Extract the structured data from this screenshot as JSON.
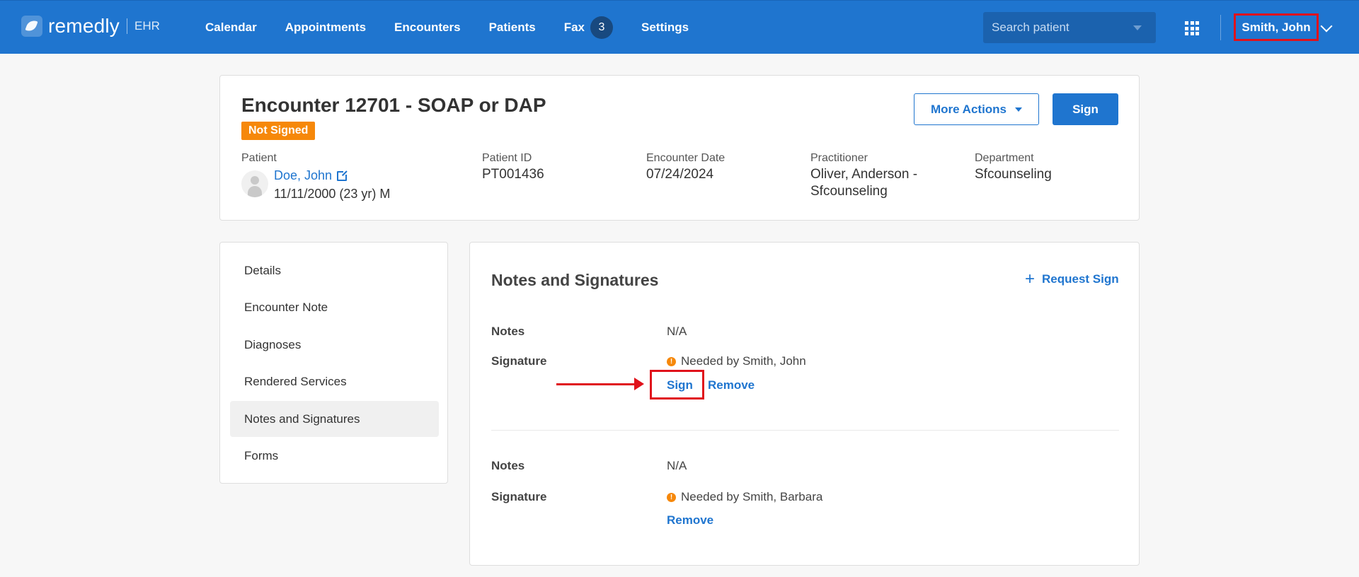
{
  "app": {
    "name": "remedly",
    "suffix": "EHR"
  },
  "nav": {
    "items": [
      "Calendar",
      "Appointments",
      "Encounters",
      "Patients",
      "Fax",
      "Settings"
    ],
    "fax_count": "3",
    "search_placeholder": "Search patient",
    "user": "Smith, John"
  },
  "encounter": {
    "title": "Encounter 12701 - SOAP or DAP",
    "status": "Not Signed",
    "more_actions": "More Actions",
    "sign": "Sign",
    "patient_label": "Patient",
    "patient_name": "Doe, John",
    "patient_dob": "11/11/2000 (23 yr) M",
    "patient_id_label": "Patient ID",
    "patient_id": "PT001436",
    "date_label": "Encounter Date",
    "date": "07/24/2024",
    "practitioner_label": "Practitioner",
    "practitioner_line1": "Oliver, Anderson -",
    "practitioner_line2": "Sfcounseling",
    "department_label": "Department",
    "department": "Sfcounseling"
  },
  "sidebar": {
    "items": [
      "Details",
      "Encounter Note",
      "Diagnoses",
      "Rendered Services",
      "Notes and Signatures",
      "Forms"
    ],
    "active": "Notes and Signatures"
  },
  "notes": {
    "title": "Notes and Signatures",
    "request_sign": "Request Sign",
    "entries": [
      {
        "notes_label": "Notes",
        "notes_value": "N/A",
        "signature_label": "Signature",
        "needed": "Needed by Smith, John",
        "sign": "Sign",
        "remove": "Remove"
      },
      {
        "notes_label": "Notes",
        "notes_value": "N/A",
        "signature_label": "Signature",
        "needed": "Needed by Smith, Barbara",
        "remove": "Remove"
      }
    ]
  },
  "colors": {
    "brand": "#1f75cf",
    "status": "#f6880a",
    "highlight": "#e0121b"
  }
}
